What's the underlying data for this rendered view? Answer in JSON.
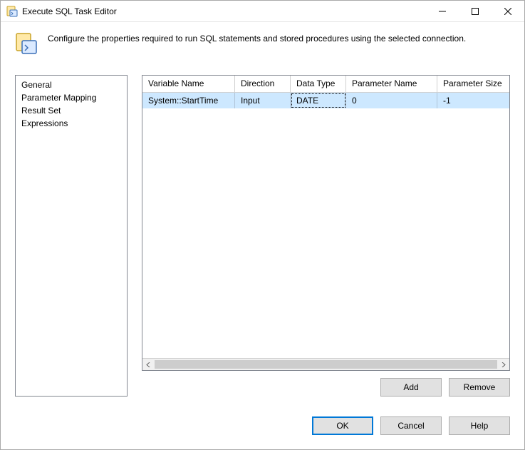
{
  "window": {
    "title": "Execute SQL Task Editor",
    "description": "Configure the properties required to run SQL statements and stored procedures using the selected connection."
  },
  "sidebar": {
    "items": [
      {
        "label": "General"
      },
      {
        "label": "Parameter Mapping"
      },
      {
        "label": "Result Set"
      },
      {
        "label": "Expressions"
      }
    ],
    "selected_index": 1
  },
  "grid": {
    "columns": {
      "variable_name": "Variable Name",
      "direction": "Direction",
      "data_type": "Data Type",
      "parameter_name": "Parameter Name",
      "parameter_size": "Parameter Size"
    },
    "rows": [
      {
        "variable_name": "System::StartTime",
        "direction": "Input",
        "data_type": "DATE",
        "parameter_name": "0",
        "parameter_size": "-1"
      }
    ]
  },
  "buttons": {
    "add": "Add",
    "remove": "Remove",
    "ok": "OK",
    "cancel": "Cancel",
    "help": "Help"
  }
}
